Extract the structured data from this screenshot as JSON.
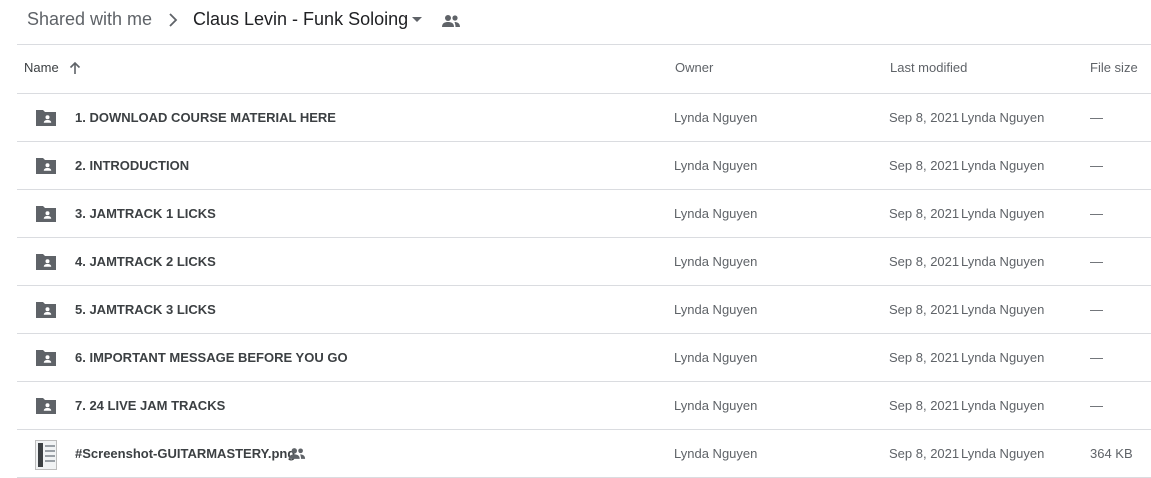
{
  "breadcrumb": {
    "root": "Shared with me",
    "current": "Claus Levin - Funk Soloing"
  },
  "columns": {
    "name": "Name",
    "owner": "Owner",
    "last_modified": "Last modified",
    "file_size": "File size"
  },
  "rows": [
    {
      "name": "1. DOWNLOAD COURSE MATERIAL HERE",
      "owner": "Lynda Nguyen",
      "modified_date": "Sep 8, 2021",
      "modified_by": "Lynda Nguyen",
      "size": "—",
      "icon": "shared-folder-icon"
    },
    {
      "name": "2. INTRODUCTION",
      "owner": "Lynda Nguyen",
      "modified_date": "Sep 8, 2021",
      "modified_by": "Lynda Nguyen",
      "size": "—",
      "icon": "shared-folder-icon"
    },
    {
      "name": "3. JAMTRACK 1 LICKS",
      "owner": "Lynda Nguyen",
      "modified_date": "Sep 8, 2021",
      "modified_by": "Lynda Nguyen",
      "size": "—",
      "icon": "shared-folder-icon"
    },
    {
      "name": "4. JAMTRACK 2 LICKS",
      "owner": "Lynda Nguyen",
      "modified_date": "Sep 8, 2021",
      "modified_by": "Lynda Nguyen",
      "size": "—",
      "icon": "shared-folder-icon"
    },
    {
      "name": "5. JAMTRACK 3 LICKS",
      "owner": "Lynda Nguyen",
      "modified_date": "Sep 8, 2021",
      "modified_by": "Lynda Nguyen",
      "size": "—",
      "icon": "shared-folder-icon"
    },
    {
      "name": "6. IMPORTANT MESSAGE BEFORE YOU GO",
      "owner": "Lynda Nguyen",
      "modified_date": "Sep 8, 2021",
      "modified_by": "Lynda Nguyen",
      "size": "—",
      "icon": "shared-folder-icon"
    },
    {
      "name": "7. 24 LIVE JAM TRACKS",
      "owner": "Lynda Nguyen",
      "modified_date": "Sep 8, 2021",
      "modified_by": "Lynda Nguyen",
      "size": "—",
      "icon": "shared-folder-icon"
    },
    {
      "name": "#Screenshot-GUITARMASTERY.png",
      "owner": "Lynda Nguyen",
      "modified_date": "Sep 8, 2021",
      "modified_by": "Lynda Nguyen",
      "size": "364 KB",
      "icon": "image-thumbnail-icon"
    }
  ],
  "colors": {
    "divider": "#dadce0",
    "icon": "#5f6368",
    "text": "#3c4043"
  }
}
